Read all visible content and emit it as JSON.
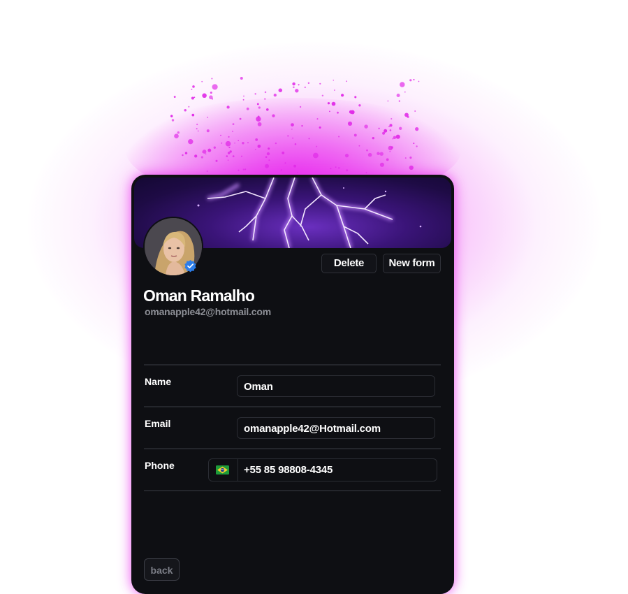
{
  "profile": {
    "name": "Oman Ramalho",
    "email": "omanapple42@hotmail.com",
    "avatar_icon": "user-photo",
    "verified_icon": "verified-badge-icon",
    "accent_color": "#e63cf0",
    "verified_color": "#2b7de9"
  },
  "actions": {
    "delete_label": "Delete",
    "new_form_label": "New form"
  },
  "form": {
    "name_label": "Name",
    "name_value": "Oman",
    "email_label": "Email",
    "email_value": "omanapple42@Hotmail.com",
    "phone_label": "Phone",
    "phone_value": "+55 85 98808-4345",
    "phone_flag_icon": "brazil-flag-icon"
  },
  "footer": {
    "back_label": "back"
  }
}
